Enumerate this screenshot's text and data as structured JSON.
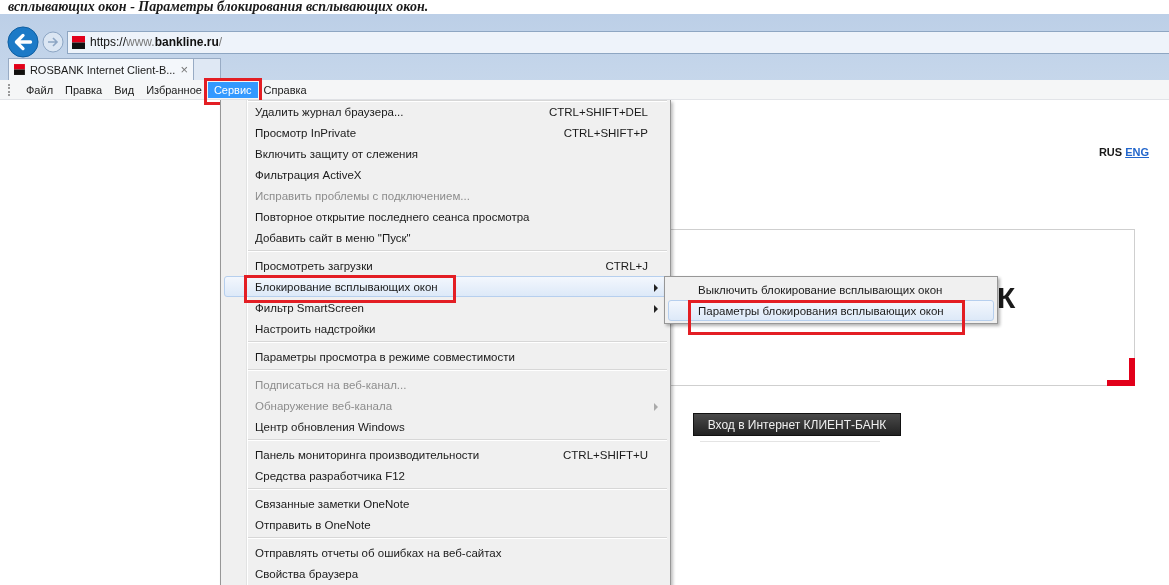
{
  "caption": "всплывающих окон - Параметры блокирования всплывающих окон.",
  "address_bar": {
    "url_parts": [
      {
        "text": "https://",
        "dim": false
      },
      {
        "text": "www.",
        "dim": true
      },
      {
        "text": "bankline.ru",
        "dim": false
      },
      {
        "text": "/",
        "dim": true
      }
    ]
  },
  "tabs": [
    {
      "label": "ROSBANK Internet Client-B...",
      "close": "×",
      "selected": true
    }
  ],
  "menu_bar": [
    {
      "label": "Файл",
      "selected": false,
      "marked": false
    },
    {
      "label": "Правка",
      "selected": false,
      "marked": false
    },
    {
      "label": "Вид",
      "selected": false,
      "marked": false
    },
    {
      "label": "Избранное",
      "selected": false,
      "marked": false
    },
    {
      "label": "Сервис",
      "selected": true,
      "marked": true
    },
    {
      "label": "Справка",
      "selected": false,
      "marked": false
    }
  ],
  "menu": {
    "groups": [
      {
        "items": [
          {
            "label": "Удалить журнал браузера...",
            "shortcut": "CTRL+SHIFT+DEL",
            "disabled": false,
            "submenu": false,
            "selected": false,
            "marked": false
          },
          {
            "label": "Просмотр InPrivate",
            "shortcut": "CTRL+SHIFT+P",
            "disabled": false,
            "submenu": false,
            "selected": false,
            "marked": false
          },
          {
            "label": "Включить защиту от слежения",
            "disabled": false,
            "submenu": false,
            "selected": false,
            "marked": false
          },
          {
            "label": "Фильтрация ActiveX",
            "disabled": false,
            "submenu": false,
            "selected": false,
            "marked": false
          },
          {
            "label": "Исправить проблемы с подключением...",
            "disabled": true,
            "submenu": false,
            "selected": false,
            "marked": false
          },
          {
            "label": "Повторное открытие последнего сеанса просмотра",
            "disabled": false,
            "submenu": false,
            "selected": false,
            "marked": false
          },
          {
            "label": "Добавить сайт в меню \"Пуск\"",
            "disabled": false,
            "submenu": false,
            "selected": false,
            "marked": false
          }
        ]
      },
      {
        "items": [
          {
            "label": "Просмотреть загрузки",
            "shortcut": "CTRL+J",
            "disabled": false,
            "submenu": false,
            "selected": false,
            "marked": false
          },
          {
            "label": "Блокирование всплывающих окон",
            "disabled": false,
            "submenu": true,
            "selected": true,
            "marked": true
          },
          {
            "label": "Фильтр SmartScreen",
            "disabled": false,
            "submenu": true,
            "selected": false,
            "marked": false
          },
          {
            "label": "Настроить надстройки",
            "disabled": false,
            "submenu": false,
            "selected": false,
            "marked": false
          }
        ]
      },
      {
        "items": [
          {
            "label": "Параметры просмотра в режиме совместимости",
            "disabled": false,
            "submenu": false,
            "selected": false,
            "marked": false
          }
        ]
      },
      {
        "items": [
          {
            "label": "Подписаться на веб-канал...",
            "disabled": true,
            "submenu": false,
            "selected": false,
            "marked": false
          },
          {
            "label": "Обнаружение веб-канала",
            "disabled": true,
            "submenu": true,
            "selected": false,
            "marked": false
          },
          {
            "label": "Центр обновления Windows",
            "disabled": false,
            "submenu": false,
            "selected": false,
            "marked": false
          }
        ]
      },
      {
        "items": [
          {
            "label": "Панель мониторинга производительности",
            "shortcut": "CTRL+SHIFT+U",
            "disabled": false,
            "submenu": false,
            "selected": false,
            "marked": false
          },
          {
            "label": "Средства разработчика F12",
            "disabled": false,
            "submenu": false,
            "selected": false,
            "marked": false
          }
        ]
      },
      {
        "items": [
          {
            "label": "Связанные заметки OneNote",
            "disabled": false,
            "submenu": false,
            "selected": false,
            "marked": false
          },
          {
            "label": "Отправить в OneNote",
            "disabled": false,
            "submenu": false,
            "selected": false,
            "marked": false
          }
        ]
      },
      {
        "items": [
          {
            "label": "Отправлять отчеты об ошибках на веб-сайтах",
            "disabled": false,
            "submenu": false,
            "selected": false,
            "marked": false
          },
          {
            "label": "Свойства браузера",
            "disabled": false,
            "submenu": false,
            "selected": false,
            "marked": false
          }
        ]
      }
    ]
  },
  "submenu": {
    "items": [
      {
        "label": "Выключить блокирование всплывающих окон",
        "selected": false,
        "marked": false
      },
      {
        "label": "Параметры блокирования всплывающих окон",
        "selected": true,
        "marked": true
      }
    ]
  },
  "page": {
    "languages": [
      {
        "label": "RUS",
        "link": false
      },
      {
        "label": "ENG",
        "link": true
      }
    ],
    "logo_fragment": "К",
    "login_button": "Вход в Интернет КЛИЕНТ-БАНК"
  }
}
